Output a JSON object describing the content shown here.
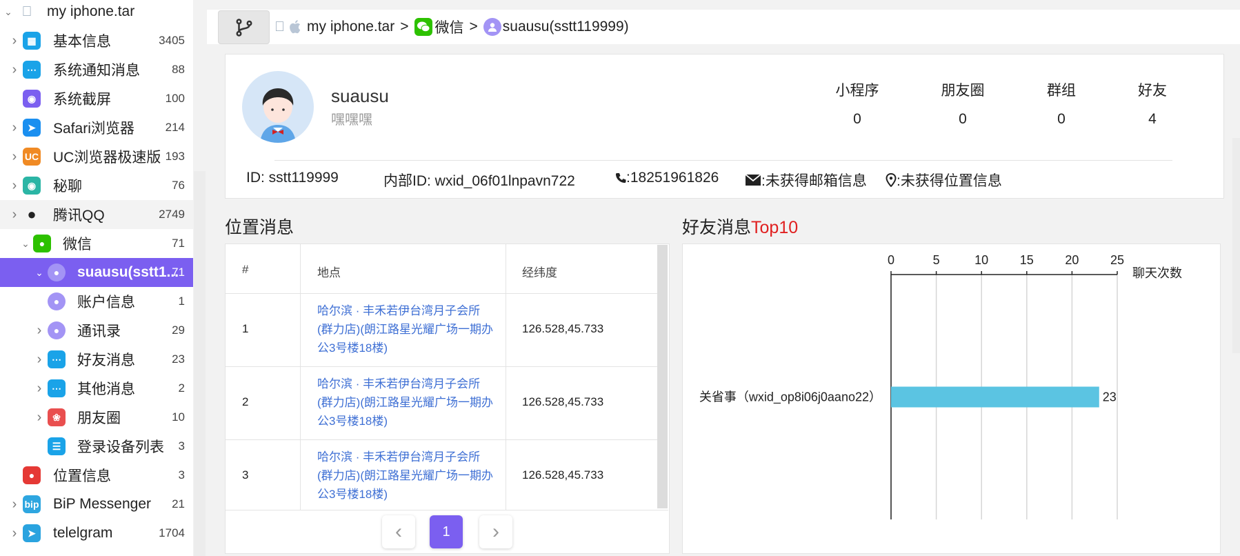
{
  "sidebar": {
    "root": {
      "label": "my iphone.tar",
      "icon": "apple-icon"
    },
    "items": [
      {
        "label": "基本信息",
        "count": "3405",
        "icon": "grid-icon",
        "color": "#1aa3e8"
      },
      {
        "label": "系统通知消息",
        "count": "88",
        "icon": "chat-bubble-icon",
        "color": "#1aa3e8"
      },
      {
        "label": "系统截屏",
        "count": "100",
        "icon": "camera-icon",
        "color": "#7b5ff0"
      },
      {
        "label": "Safari浏览器",
        "count": "214",
        "icon": "compass-icon",
        "color": "#1a8ff0"
      },
      {
        "label": "UC浏览器极速版",
        "count": "193",
        "icon": "uc-icon",
        "color": "#f08a24"
      },
      {
        "label": "秘聊",
        "count": "76",
        "icon": "mask-icon",
        "color": "#2bb5a5"
      },
      {
        "label": "腾讯QQ",
        "count": "2749",
        "icon": "qq-penguin-icon",
        "color": "#222222"
      },
      {
        "label": "微信",
        "count": "71",
        "icon": "wechat-icon",
        "color": "#2dc100"
      },
      {
        "label": "suausu(sstt1...",
        "count": "71",
        "icon": "user-icon",
        "color": "#a394f5"
      },
      {
        "label": "账户信息",
        "count": "1",
        "icon": "user-icon",
        "color": "#a394f5"
      },
      {
        "label": "通讯录",
        "count": "29",
        "icon": "user-icon",
        "color": "#a394f5"
      },
      {
        "label": "好友消息",
        "count": "23",
        "icon": "chat-bubble-icon",
        "color": "#1aa3e8"
      },
      {
        "label": "其他消息",
        "count": "2",
        "icon": "chat-bubble-icon",
        "color": "#1aa3e8"
      },
      {
        "label": "朋友圈",
        "count": "10",
        "icon": "aperture-icon",
        "color": "#e94f4f"
      },
      {
        "label": "登录设备列表",
        "count": "3",
        "icon": "list-icon",
        "color": "#1aa3e8"
      },
      {
        "label": "位置信息",
        "count": "3",
        "icon": "map-pin-icon",
        "color": "#e53935"
      },
      {
        "label": "BiP Messenger",
        "count": "21",
        "icon": "bip-icon",
        "color": "#2ea6e0"
      },
      {
        "label": "telelgram",
        "count": "1704",
        "icon": "telegram-icon",
        "color": "#2aa3df"
      }
    ]
  },
  "breadcrumb": {
    "root": "my iphone.tar",
    "app": "微信",
    "account": "suausu(sstt119999)",
    "sep": ">"
  },
  "profile": {
    "name": "suausu",
    "signature": "嘿嘿嘿",
    "stats": [
      {
        "label": "小程序",
        "value": "0"
      },
      {
        "label": "朋友圈",
        "value": "0"
      },
      {
        "label": "群组",
        "value": "0"
      },
      {
        "label": "好友",
        "value": "4"
      }
    ],
    "id": "ID: sstt119999",
    "internal_id": "内部ID: wxid_06f01lnpavn722",
    "phone": ":18251961826",
    "email": ":未获得邮箱信息",
    "location": ":未获得位置信息"
  },
  "location_section": {
    "title": "位置消息",
    "columns": [
      "#",
      "地点",
      "经纬度"
    ],
    "rows": [
      {
        "no": "1",
        "place": "哈尔滨 · 丰禾若伊台湾月子会所(群力店)(朗江路星光耀广场一期办公3号楼18楼)",
        "coord": "126.528,45.733"
      },
      {
        "no": "2",
        "place": "哈尔滨 · 丰禾若伊台湾月子会所(群力店)(朗江路星光耀广场一期办公3号楼18楼)",
        "coord": "126.528,45.733"
      },
      {
        "no": "3",
        "place": "哈尔滨 · 丰禾若伊台湾月子会所(群力店)(朗江路星光耀广场一期办公3号楼18楼)",
        "coord": "126.528,45.733"
      }
    ],
    "pagination": {
      "prev": "‹",
      "current": "1",
      "next": "›"
    }
  },
  "friends_section": {
    "title_main": "好友消息",
    "title_accent": "Top10",
    "accent_color": "#e02020"
  },
  "chart_data": {
    "type": "bar",
    "orientation": "horizontal",
    "categories": [
      "关省事（wxid_op8i06j0aano22）"
    ],
    "values": [
      23
    ],
    "data_labels": [
      "23"
    ],
    "xlabel": "聊天次数",
    "xlim": [
      0,
      25
    ],
    "x_ticks": [
      "0",
      "5",
      "10",
      "15",
      "20",
      "25"
    ],
    "axis_position": "top",
    "grid": true,
    "bar_color": "#5bc4e2"
  }
}
